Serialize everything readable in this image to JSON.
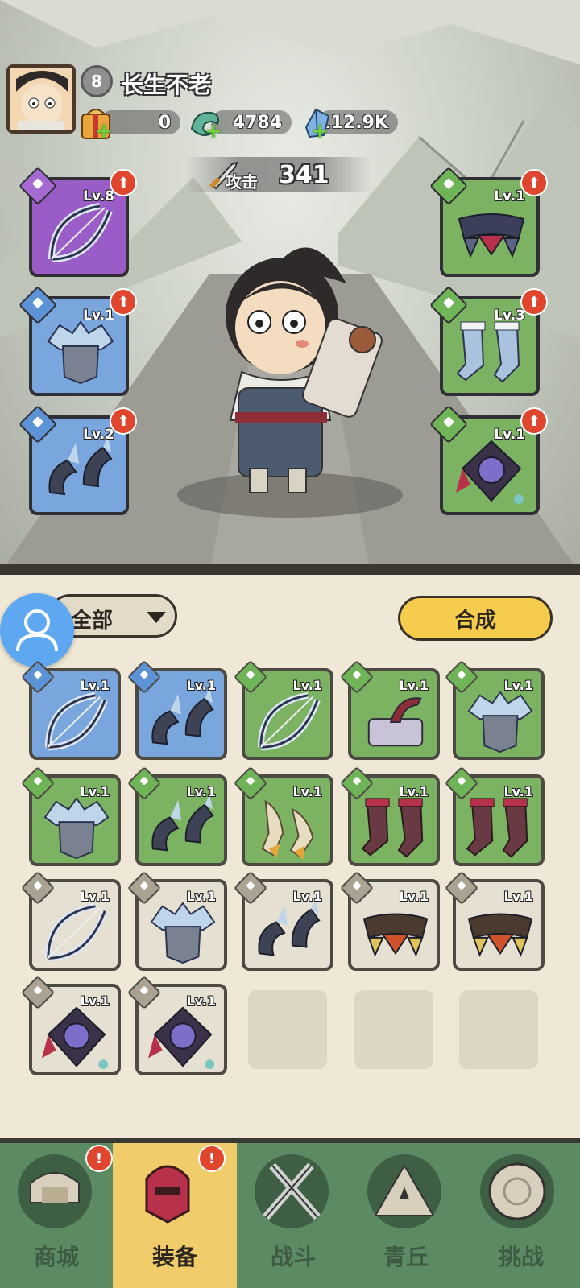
{
  "player": {
    "level": "8",
    "name": "长生不老"
  },
  "resources": [
    {
      "name": "gift-pack",
      "value": "0"
    },
    {
      "name": "jade-dragon",
      "value": "4784"
    },
    {
      "name": "crystal",
      "value": "112.9K"
    }
  ],
  "attack": {
    "label": "攻击",
    "value": "341"
  },
  "equipped_left": [
    {
      "slot": "weapon",
      "rarity": "purple",
      "level": "Lv.8",
      "icon": "bow-icon"
    },
    {
      "slot": "armor",
      "rarity": "blue",
      "level": "Lv.1",
      "icon": "armor-icon"
    },
    {
      "slot": "bracer",
      "rarity": "blue",
      "level": "Lv.2",
      "icon": "bracer-icon"
    }
  ],
  "equipped_right": [
    {
      "slot": "belt",
      "rarity": "green",
      "level": "Lv.1",
      "icon": "belt-icon"
    },
    {
      "slot": "boots",
      "rarity": "green",
      "level": "Lv.3",
      "icon": "boots-icon"
    },
    {
      "slot": "amulet",
      "rarity": "green",
      "level": "Lv.1",
      "icon": "amulet-icon"
    }
  ],
  "inventory": {
    "filter_label": "全部",
    "synth_label": "合成",
    "items": [
      {
        "rarity": "blue",
        "level": "Lv.1",
        "icon": "bow-icon"
      },
      {
        "rarity": "blue",
        "level": "Lv.1",
        "icon": "bracer-icon"
      },
      {
        "rarity": "green",
        "level": "Lv.1",
        "icon": "bow-icon"
      },
      {
        "rarity": "green",
        "level": "Lv.1",
        "icon": "anvil-icon"
      },
      {
        "rarity": "green",
        "level": "Lv.1",
        "icon": "armor-icon"
      },
      {
        "rarity": "green",
        "level": "Lv.1",
        "icon": "armor-icon"
      },
      {
        "rarity": "green",
        "level": "Lv.1",
        "icon": "bracer-icon"
      },
      {
        "rarity": "green",
        "level": "Lv.1",
        "icon": "gauntlet-icon"
      },
      {
        "rarity": "green",
        "level": "Lv.1",
        "icon": "boots-icon"
      },
      {
        "rarity": "green",
        "level": "Lv.1",
        "icon": "boots-icon"
      },
      {
        "rarity": "gray",
        "level": "Lv.1",
        "icon": "bow-icon"
      },
      {
        "rarity": "gray",
        "level": "Lv.1",
        "icon": "armor-icon"
      },
      {
        "rarity": "gray",
        "level": "Lv.1",
        "icon": "bracer-icon"
      },
      {
        "rarity": "gray",
        "level": "Lv.1",
        "icon": "belt-icon"
      },
      {
        "rarity": "gray",
        "level": "Lv.1",
        "icon": "belt-icon"
      },
      {
        "rarity": "gray",
        "level": "Lv.1",
        "icon": "amulet-icon"
      },
      {
        "rarity": "gray",
        "level": "Lv.1",
        "icon": "amulet-icon"
      }
    ]
  },
  "nav": [
    {
      "label": "商城",
      "icon": "shop-icon",
      "alert": "!"
    },
    {
      "label": "装备",
      "icon": "equipment-icon",
      "alert": "!",
      "active": true
    },
    {
      "label": "战斗",
      "icon": "battle-icon"
    },
    {
      "label": "青丘",
      "icon": "qingqiu-icon"
    },
    {
      "label": "挑战",
      "icon": "challenge-icon"
    }
  ]
}
